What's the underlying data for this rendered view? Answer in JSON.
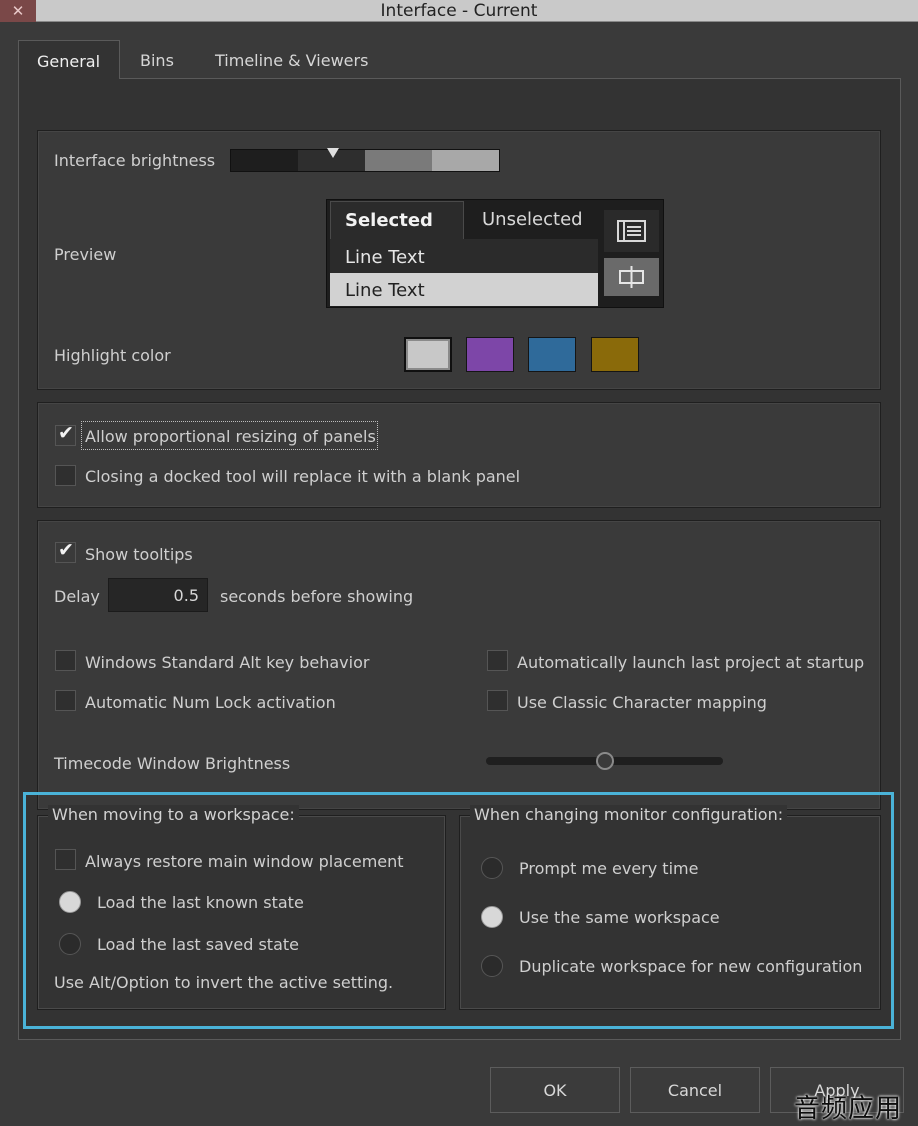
{
  "window": {
    "title": "Interface - Current",
    "close_glyph": "✕"
  },
  "tabs": [
    {
      "label": "General",
      "active": true
    },
    {
      "label": "Bins",
      "active": false
    },
    {
      "label": "Timeline & Viewers",
      "active": false
    }
  ],
  "appearance": {
    "brightness_label": "Interface brightness",
    "brightness_level": 0.38,
    "preview_label": "Preview",
    "preview_tabs": [
      "Selected",
      "Unselected"
    ],
    "preview_rows": [
      "Line Text",
      "Line Text"
    ],
    "highlight_label": "Highlight color",
    "highlight_colors": [
      "#c8c8c8",
      "#7d46a8",
      "#2f6a9a",
      "#8a6a0a"
    ]
  },
  "panels": {
    "allow_resizing": {
      "label": "Allow proportional resizing of panels",
      "checked": true
    },
    "closing_docked": {
      "label": "Closing a docked tool will replace it with a blank panel",
      "checked": false
    }
  },
  "tooltips": {
    "show_tooltips": {
      "label": "Show tooltips",
      "checked": true
    },
    "delay_label": "Delay",
    "delay_value": "0.5",
    "delay_suffix": "seconds before showing"
  },
  "misc": {
    "win_alt": {
      "label": "Windows Standard Alt key behavior",
      "checked": false
    },
    "auto_launch": {
      "label": "Automatically launch last project at startup",
      "checked": false
    },
    "num_lock": {
      "label": "Automatic Num Lock activation",
      "checked": false
    },
    "classic_char": {
      "label": "Use Classic Character mapping",
      "checked": false
    },
    "tc_brightness_label": "Timecode Window Brightness",
    "tc_brightness_level": 0.5
  },
  "workspace": {
    "legend": "When moving to a workspace:",
    "always_restore": {
      "label": "Always restore main window placement",
      "checked": false
    },
    "load_last_known": {
      "label": "Load the last known state",
      "selected": true
    },
    "load_last_saved": {
      "label": "Load the last saved state",
      "selected": false
    },
    "hint": "Use Alt/Option to invert the active setting."
  },
  "monitor": {
    "legend": "When changing monitor configuration:",
    "prompt": {
      "label": "Prompt me every time",
      "selected": false
    },
    "same": {
      "label": "Use the same workspace",
      "selected": true
    },
    "duplicate": {
      "label": "Duplicate workspace for new configuration",
      "selected": false
    }
  },
  "buttons": {
    "ok": "OK",
    "cancel": "Cancel",
    "apply": "Apply"
  },
  "colors": {
    "highlight_frame": "#4ab3d8",
    "panel_bg": "#3a3a3a"
  },
  "watermark": "音频应用"
}
